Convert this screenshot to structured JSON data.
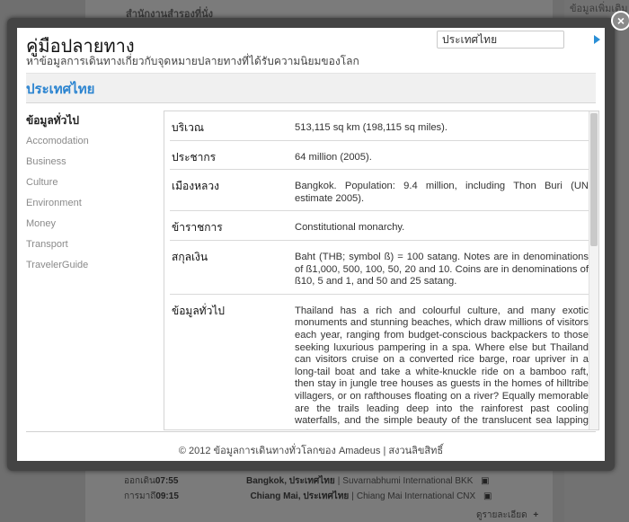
{
  "background": {
    "top_text": "สำนักงานสำรองที่นั่ง",
    "top_right_text": "ข้อมูลเพิ่มเติม",
    "rows": [
      {
        "label": "ออกเดิน",
        "time": "07:55",
        "city": "Bangkok, ประเทศไทย",
        "sep": "|",
        "airport": "Suvarnabhumi International BKK"
      },
      {
        "label": "การมาถึ",
        "time": "09:15",
        "city": "Chiang Mai, ประเทศไทย",
        "sep": "|",
        "airport": "Chiang Mai International CNX"
      }
    ],
    "details_link": "ดูรายละเอียด"
  },
  "modal": {
    "title": "คู่มือปลายทาง",
    "subtitle": "หาข้อมูลการเดินทางเกี่ยวกับจุดหมายปลายทางที่ได้รับความนิยมของโลก",
    "search_value": "ประเทศไทย",
    "close_glyph": "×",
    "country": "ประเทศไทย",
    "nav": [
      "ข้อมูลทั่วไป",
      "Accomodation",
      "Business",
      "Culture",
      "Environment",
      "Money",
      "Transport",
      "TravelerGuide"
    ],
    "info": [
      {
        "key": "บริเวณ",
        "value": "513,115 sq km (198,115 sq miles)."
      },
      {
        "key": "ประชากร",
        "value": "64 million (2005)."
      },
      {
        "key": "เมืองหลวง",
        "value": "Bangkok. Population: 9.4 million, including Thon Buri (UN estimate 2005)."
      },
      {
        "key": "ข้าราชการ",
        "value": "Constitutional monarchy."
      },
      {
        "key": "สกุลเงิน",
        "value": "Baht (THB; symbol ß) = 100 satang. Notes are in denominations of ß1,000, 500, 100, 50, 20 and 10. Coins are in denominations of ß10, 5 and 1, and 50 and 25 satang."
      },
      {
        "key": "ข้อมูลทั่วไป",
        "value": "Thailand has a rich and colourful culture, and many exotic monuments and stunning beaches, which draw millions of visitors each year, ranging from budget-conscious backpackers to those seeking luxurious pampering in a spa. Where else but Thailand can visitors cruise on a converted rice barge, roar upriver in a long-tail boat and take a white-knuckle ride on a bamboo raft, then stay in jungle tree houses as guests in the homes of hilltribe villagers, or on rafthouses floating on a river? Equally memorable are the trails leading deep into the rainforest past cooling waterfalls, and the simple beauty of the translucent sea lapping onto"
      }
    ],
    "footer": "© 2012 ข้อมูลการเดินทางทั่วโลกของ Amadeus | สงวนลิขสิทธิ์"
  }
}
